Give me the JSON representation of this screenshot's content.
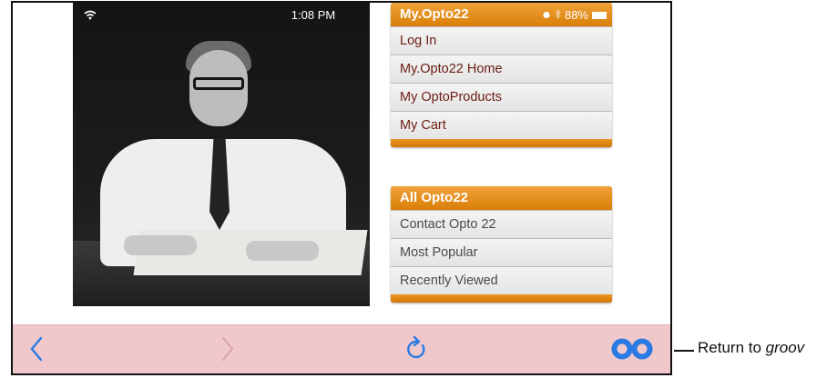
{
  "status_bar": {
    "time": "1:08 PM",
    "battery": "88%"
  },
  "menu_myopto": {
    "title": "My.Opto22",
    "items": [
      "Log In",
      "My.Opto22 Home",
      "My OptoProducts",
      "My Cart"
    ]
  },
  "menu_all": {
    "title": "All Opto22",
    "items": [
      "Contact Opto 22",
      "Most Popular",
      "Recently Viewed"
    ]
  },
  "toolbar": {
    "back_icon": "chevron-left-icon",
    "forward_icon": "chevron-right-icon",
    "reload_icon": "reload-icon",
    "groov_icon": "infinity-icon"
  },
  "callout": {
    "prefix": "Return to ",
    "emphasis": "groov"
  },
  "colors": {
    "menu_orange": "#e08a12",
    "menu_text": "#6b1d12",
    "toolbar_bg": "#f0c8cc",
    "toolbar_icon": "#2a7ae4"
  }
}
